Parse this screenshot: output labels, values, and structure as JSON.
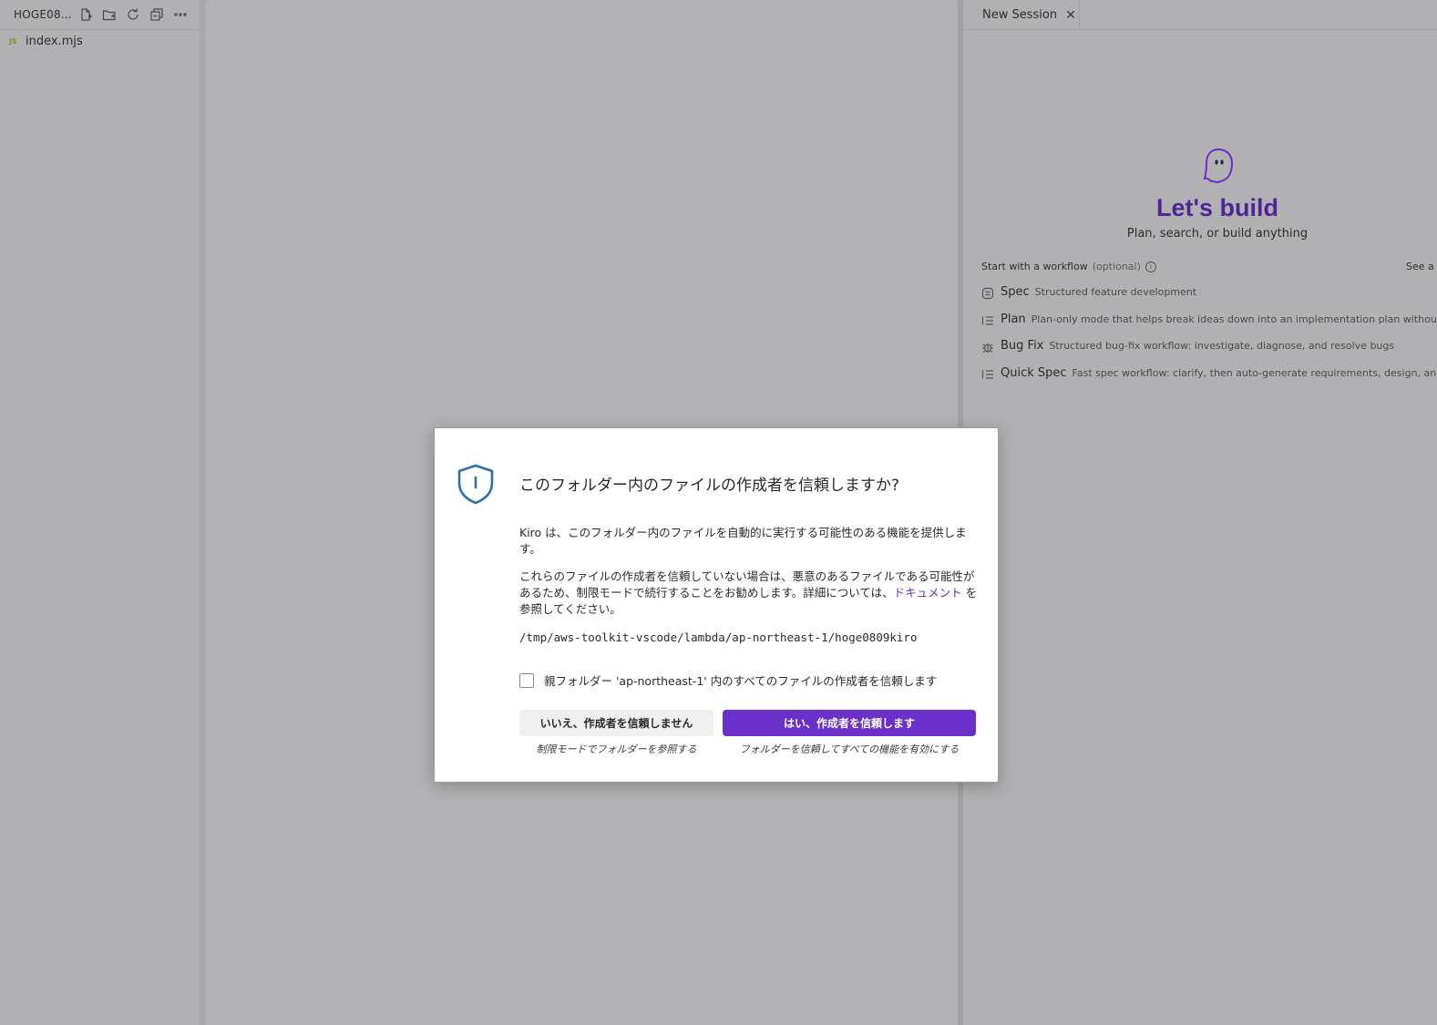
{
  "sidebar": {
    "title": "HOGE08...",
    "actions": [
      "new-file-icon",
      "new-folder-icon",
      "refresh-icon",
      "collapse-all-icon",
      "more-icon"
    ],
    "files": [
      {
        "badge": "JS",
        "name": "index.mjs"
      }
    ]
  },
  "chat": {
    "tab_label": "New Session",
    "tab_close": "✕",
    "heading": "Let's build",
    "subheading": "Plan, search, or build anything",
    "workflow_label": "Start with a workflow",
    "workflow_optional": "(optional)",
    "see_all": "See a",
    "workflows": [
      {
        "name": "Spec",
        "desc": "Structured feature development"
      },
      {
        "name": "Plan",
        "desc": "Plan-only mode that helps break ideas down into an implementation plan without ma"
      },
      {
        "name": "Bug Fix",
        "desc": "Structured bug-fix workflow: investigate, diagnose, and resolve bugs"
      },
      {
        "name": "Quick Spec",
        "desc": "Fast spec workflow: clarify, then auto-generate requirements, design, and ta"
      }
    ],
    "accent_color": "#4f2597"
  },
  "dialog": {
    "title": "このフォルダー内のファイルの作成者を信頼しますか?",
    "p1": "Kiro は、このフォルダー内のファイルを自動的に実行する可能性のある機能を提供します。",
    "p2": "これらのファイルの作成者を信頼していない場合は、悪意のあるファイルである可能性があるため、制限モードで続行することをお勧めします。詳細については、",
    "p2_link": "ドキュメント",
    "p2_end": " を参照してください。",
    "path": "/tmp/aws-toolkit-vscode/lambda/ap-northeast-1/hoge0809kiro",
    "checkbox_label": "親フォルダー 'ap-northeast-1' 内のすべてのファイルの作成者を信頼します",
    "checkbox_checked": false,
    "no_button": "いいえ、作成者を信頼しません",
    "no_caption": "制限モードでフォルダーを参照する",
    "yes_button": "はい、作成者を信頼します",
    "yes_caption": "フォルダーを信頼してすべての機能を有効にする",
    "primary_color": "#6a30c9"
  }
}
